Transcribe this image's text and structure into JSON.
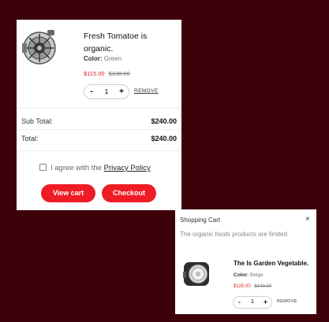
{
  "cart_panel": {
    "item": {
      "title": "Fresh Tomatoe is organic.",
      "color_label": "Color:",
      "color_value": "Green",
      "price": "$115.00",
      "old_price": "$130.00",
      "quantity": "1",
      "minus_label": "-",
      "plus_label": "+",
      "remove_label": "REMOVE",
      "image_icon": "car-alternator-icon"
    },
    "subtotal_label": "Sub Total:",
    "subtotal_value": "$240.00",
    "total_label": "Total:",
    "total_value": "$240.00",
    "agree_text": "I agree with the",
    "policy_link": "Privacy Policy",
    "view_cart_label": "View cart",
    "checkout_label": "Checkout",
    "accent_color": "#ee1c25"
  },
  "mini_cart": {
    "title": "Shopping Cart",
    "close_label": "×",
    "subtitle": "The organic foods products are limited",
    "item": {
      "title": "The Is Garden Vegetable.",
      "color_label": "Color:",
      "color_value": "Beige",
      "price": "$125.00",
      "old_price": "$140.00",
      "quantity": "1",
      "minus_label": "-",
      "plus_label": "+",
      "remove_label": "REMOVE",
      "image_icon": "fog-lamp-icon"
    }
  },
  "background_color": "#3d0209"
}
